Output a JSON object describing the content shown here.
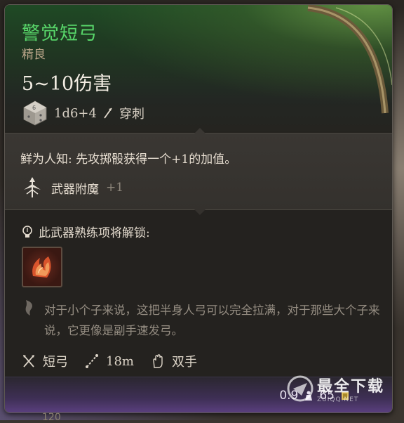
{
  "item": {
    "name": "警觉短弓",
    "rarity": "精良",
    "damage": "5~10伤害",
    "dice_formula": "1d6+4",
    "damage_type": "穿刺"
  },
  "passive": {
    "text": "鲜为人知: 先攻掷骰获得一个+1的加值。"
  },
  "enchant": {
    "label": "武器附魔",
    "value": "+1"
  },
  "unlock": {
    "text": "此武器熟练项将解锁:"
  },
  "flavor": {
    "text": "对于小个子来说，这把半身人弓可以完全拉满，对于那些大个子来说，它更像是副手速发弓。"
  },
  "stats": {
    "weapon_type": "短弓",
    "range": "18m",
    "handedness": "双手"
  },
  "footer": {
    "weight": "0.9",
    "price": "65"
  },
  "watermark": {
    "title": "最全下载",
    "sub": "ZUIQQ.NET"
  },
  "bottom": {
    "partial": "120"
  },
  "colors": {
    "name_green": "#58d66a",
    "rarity": "#b8a488",
    "footer_purple": "#5a3f7e"
  },
  "icons": [
    "dice-icon",
    "pierce-icon",
    "enchant-icon",
    "bulb-icon",
    "skill-icon",
    "quill-icon",
    "crossed-arrows-icon",
    "range-icon",
    "hand-icon",
    "weight-icon",
    "gold-icon"
  ]
}
